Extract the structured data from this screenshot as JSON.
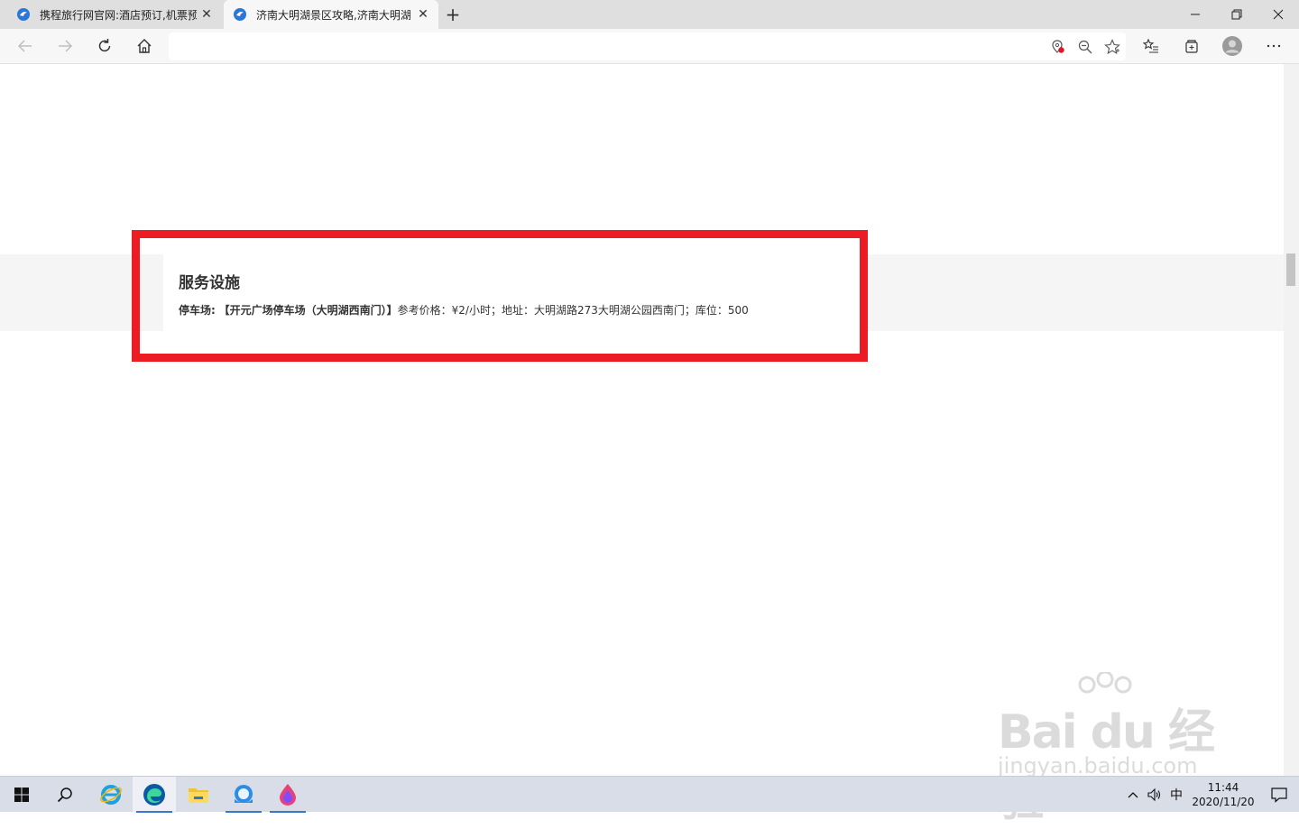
{
  "browser": {
    "tabs": [
      {
        "title": "携程旅行网官网:酒店预订,机票预",
        "active": false
      },
      {
        "title": "济南大明湖景区攻略,济南大明湖",
        "active": true
      }
    ],
    "address_bar": {
      "value": "",
      "placeholder": ""
    }
  },
  "page": {
    "section_title": "服务设施",
    "parking": {
      "label": "停车场:",
      "name": "【开元广场停车场（大明湖西南门）】",
      "details": "参考价格：¥2/小时；地址：大明湖路273大明湖公园西南门；库位：500"
    },
    "highlight_color": "#ec1c24"
  },
  "watermark": {
    "main": "Bai du 经验",
    "sub": "jingyan.baidu.com"
  },
  "taskbar": {
    "apps": [
      "start-icon",
      "search-icon",
      "internet-explorer-icon",
      "edge-icon",
      "file-explorer-icon",
      "photos-icon",
      "paint-icon"
    ],
    "ime": "中",
    "time": "11:44",
    "date": "2020/11/20"
  }
}
